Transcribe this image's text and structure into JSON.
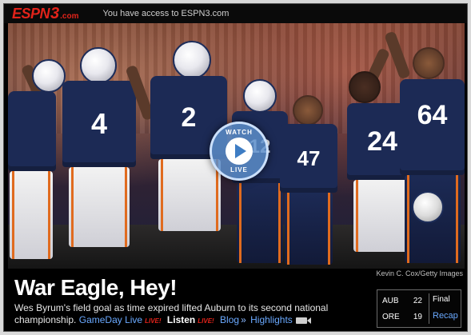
{
  "header": {
    "logo_espn": "ESPN",
    "logo_three": "3",
    "logo_dotcom": ".com",
    "access_text": "You have access to ESPN3.com"
  },
  "photo": {
    "credit": "Kevin C. Cox/Getty Images",
    "jersey_numbers": [
      "4",
      "2",
      "24",
      "64",
      "47",
      "12"
    ],
    "watch_live_top": "WATCH",
    "watch_live_bottom": "LIVE"
  },
  "story": {
    "headline": "War Eagle, Hey!",
    "summary": "Wes Byrum's field goal as time expired lifted Auburn to its second national championship.",
    "links": {
      "gameday": "GameDay Live",
      "live_tag_1": "LIVE!",
      "listen": "Listen",
      "live_tag_2": "LIVE!",
      "blog": "Blog",
      "blog_sep": "»",
      "highlights": "Highlights"
    }
  },
  "scoreboard": {
    "teams": [
      {
        "abbr": "AUB",
        "score": "22"
      },
      {
        "abbr": "ORE",
        "score": "19"
      }
    ],
    "status": "Final",
    "recap": "Recap"
  },
  "colors": {
    "brand_red": "#e2231a",
    "link_blue": "#6aa9ff",
    "jersey_navy": "#1c2a55",
    "accent_orange": "#e06b1f"
  }
}
